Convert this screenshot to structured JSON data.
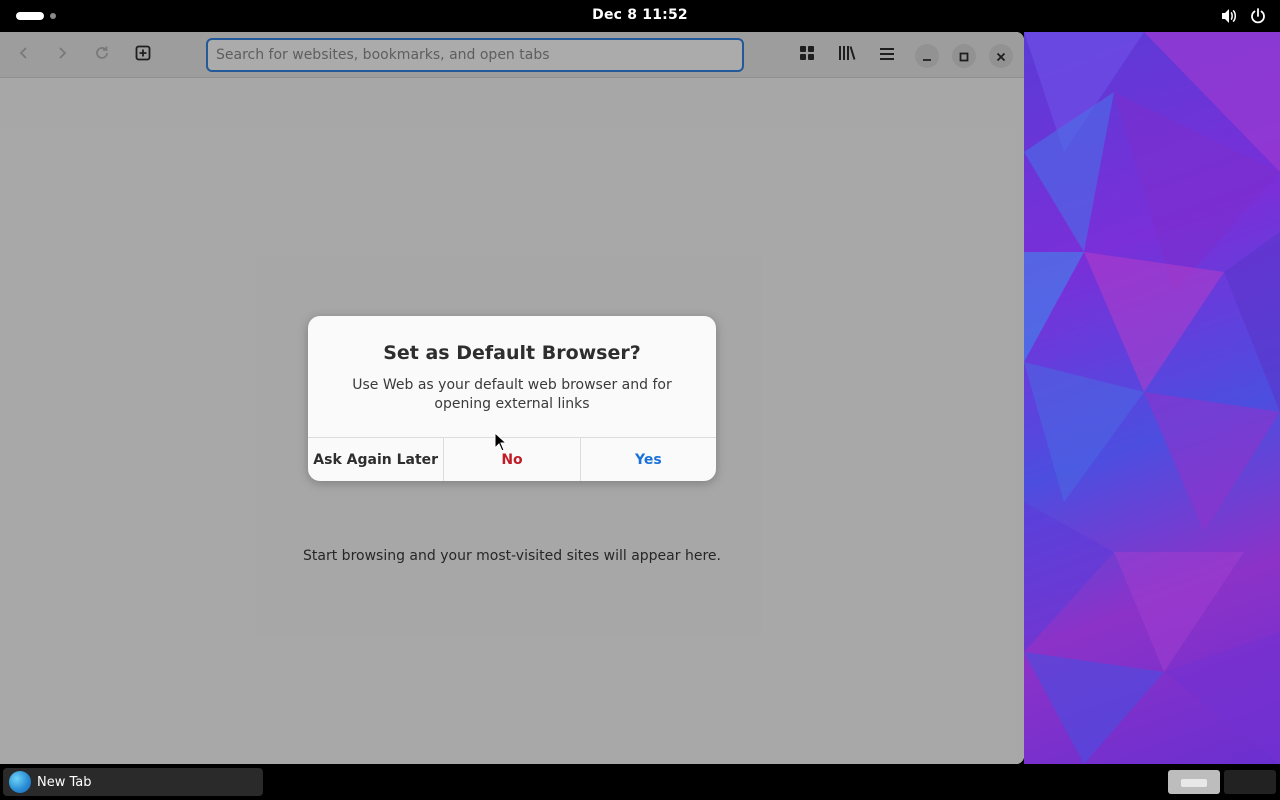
{
  "topbar": {
    "clock": "Dec 8  11:52",
    "tray_icons": [
      "volume-icon",
      "power-icon"
    ]
  },
  "browser": {
    "nav": {
      "back_icon": "chevron-left-icon",
      "forward_icon": "chevron-right-icon",
      "reload_icon": "reload-icon",
      "new_tab_icon": "new-tab-icon"
    },
    "url_placeholder": "Search for websites, bookmarks, and open tabs",
    "url_value": "",
    "toolbar_icons": [
      "tab-overview-icon",
      "library-icon",
      "hamburger-menu-icon"
    ],
    "window_controls": [
      "minimize-icon",
      "maximize-icon",
      "close-icon"
    ],
    "empty_message": "Start browsing and your most-visited sites will appear here."
  },
  "dialog": {
    "title": "Set as Default Browser?",
    "body": "Use Web as your default web browser and for opening external links",
    "buttons": {
      "later": "Ask Again Later",
      "no": "No",
      "yes": "Yes"
    }
  },
  "taskbar": {
    "task_label": "New Tab",
    "task_icon": "web-browser-icon",
    "workspaces": 2
  },
  "colors": {
    "accent": "#3584e4",
    "destructive": "#c01c28",
    "suggested": "#1c71d8"
  }
}
